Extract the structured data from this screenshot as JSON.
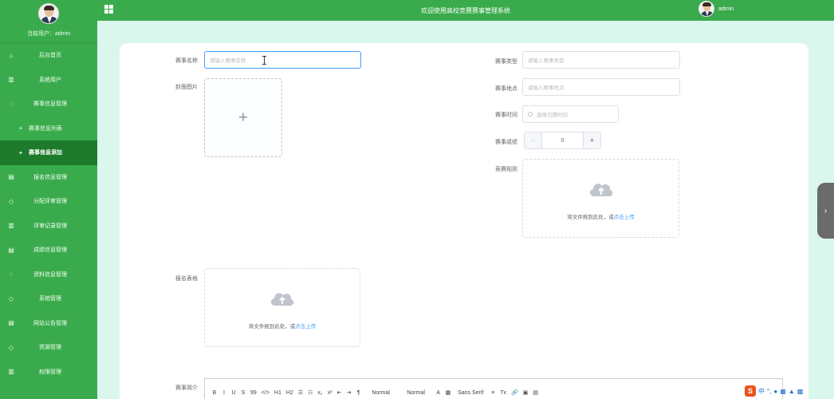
{
  "sidebar": {
    "current_user": "当前用户：admin",
    "items": [
      {
        "label": "后台首页",
        "icon": "home-icon",
        "glyph": "⌂"
      },
      {
        "label": "系统用户",
        "icon": "columns-icon",
        "glyph": "▥"
      },
      {
        "label": "赛事信息管理",
        "icon": "chat-icon",
        "glyph": "◌"
      },
      {
        "label": "赛事信息列表",
        "icon": "plus-icon",
        "glyph": "+",
        "sub": true
      },
      {
        "label": "赛事信息添加",
        "icon": "plus-icon",
        "glyph": "+",
        "sub": true,
        "active": true
      },
      {
        "label": "报名信息管理",
        "icon": "document-icon",
        "glyph": "▤"
      },
      {
        "label": "分配评审管理",
        "icon": "shield-icon",
        "glyph": "◇"
      },
      {
        "label": "评审记录管理",
        "icon": "columns-icon",
        "glyph": "▥"
      },
      {
        "label": "成绩信息管理",
        "icon": "document-icon",
        "glyph": "▤"
      },
      {
        "label": "资料信息管理",
        "icon": "chat-icon",
        "glyph": "◌"
      },
      {
        "label": "系统管理",
        "icon": "shield-icon",
        "glyph": "◇"
      },
      {
        "label": "网站公告管理",
        "icon": "document-icon",
        "glyph": "▤"
      },
      {
        "label": "资源管理",
        "icon": "shield-icon",
        "glyph": "◇"
      },
      {
        "label": "权限管理",
        "icon": "columns-icon",
        "glyph": "▥"
      }
    ]
  },
  "header": {
    "title": "欢迎使用高校竞赛赛事管理系统",
    "username": "admin"
  },
  "form": {
    "name_label": "赛事名称",
    "name_placeholder": "请输入赛事名称",
    "cover_label": "封面图片",
    "type_label": "赛事类型",
    "type_placeholder": "请输入赛事类型",
    "location_label": "赛事地点",
    "location_placeholder": "请输入赛事地点",
    "time_label": "赛事时间",
    "time_placeholder": "选择日期时间",
    "score_label": "赛事成绩",
    "score_value": "0",
    "rules_label": "竞赛规则",
    "rules_hint": "将文件拖到此处，或",
    "rules_link": "点击上传",
    "signup_label": "报名表格",
    "signup_hint": "将文件拖到此处，或",
    "signup_link": "点击上传",
    "intro_label": "赛事简介"
  },
  "editor": {
    "toolbar": [
      "B",
      "I",
      "U",
      "S",
      "99",
      "</>",
      "H1",
      "H2",
      "☰",
      "☷",
      "x₂",
      "x²",
      "⇤",
      "⇥",
      "¶",
      "Normal",
      "Normal",
      "A",
      "▦",
      "Sans Serif",
      "≡",
      "Tx",
      "🔗",
      "▣",
      "▤"
    ],
    "toolbar_icons": [
      "bold-icon",
      "italic-icon",
      "underline-icon",
      "strike-icon",
      "blockquote-icon",
      "code-icon",
      "h1-icon",
      "h2-icon",
      "ordered-list-icon",
      "bullet-list-icon",
      "subscript-icon",
      "superscript-icon",
      "outdent-icon",
      "indent-icon",
      "direction-icon",
      "size-select",
      "header-select",
      "font-color-icon",
      "background-color-icon",
      "font-select",
      "align-icon",
      "clean-icon",
      "link-icon",
      "image-icon",
      "video-icon"
    ]
  },
  "ime": {
    "logo": "S",
    "mode": "中"
  },
  "colors": {
    "sidebar": "#3aab4c",
    "active": "#1c7a2a",
    "page_bg": "#d9f7ec",
    "accent": "#409eff"
  }
}
